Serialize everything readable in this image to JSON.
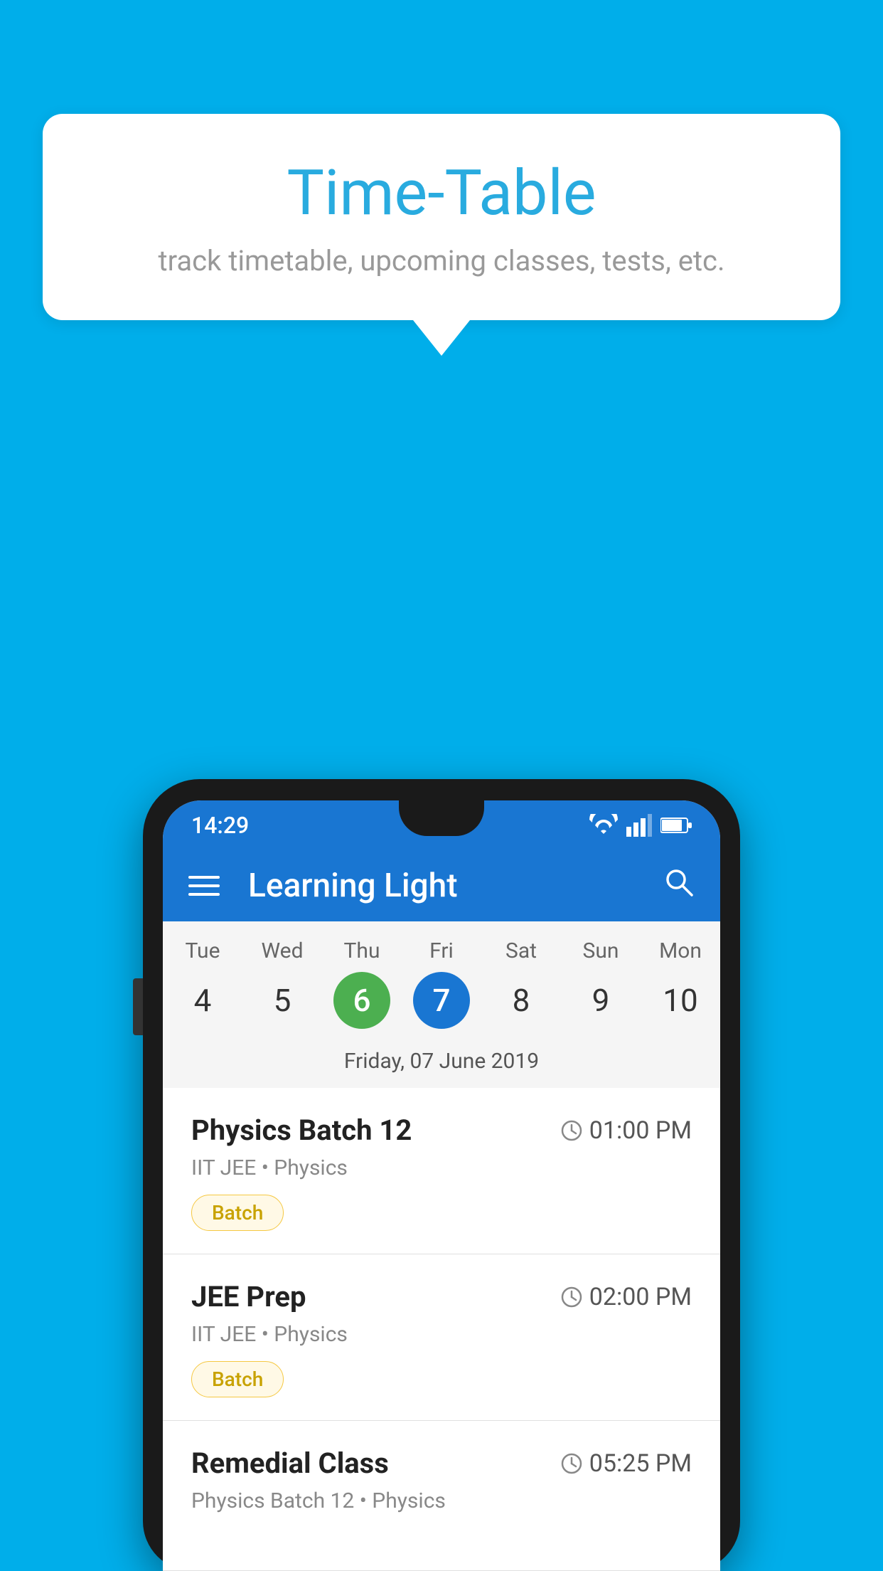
{
  "background_color": "#00AEEA",
  "speech_bubble": {
    "title": "Time-Table",
    "subtitle": "track timetable, upcoming classes, tests, etc."
  },
  "phone": {
    "status_bar": {
      "time": "14:29"
    },
    "app_bar": {
      "title": "Learning Light"
    },
    "calendar": {
      "days": [
        "Tue",
        "Wed",
        "Thu",
        "Fri",
        "Sat",
        "Sun",
        "Mon"
      ],
      "dates": [
        "4",
        "5",
        "6",
        "7",
        "8",
        "9",
        "10"
      ],
      "today_index": 2,
      "selected_index": 3,
      "selected_label": "Friday, 07 June 2019"
    },
    "classes": [
      {
        "name": "Physics Batch 12",
        "time": "01:00 PM",
        "meta": "IIT JEE • Physics",
        "badge": "Batch"
      },
      {
        "name": "JEE Prep",
        "time": "02:00 PM",
        "meta": "IIT JEE • Physics",
        "badge": "Batch"
      },
      {
        "name": "Remedial Class",
        "time": "05:25 PM",
        "meta": "Physics Batch 12 • Physics",
        "badge": null
      }
    ]
  }
}
